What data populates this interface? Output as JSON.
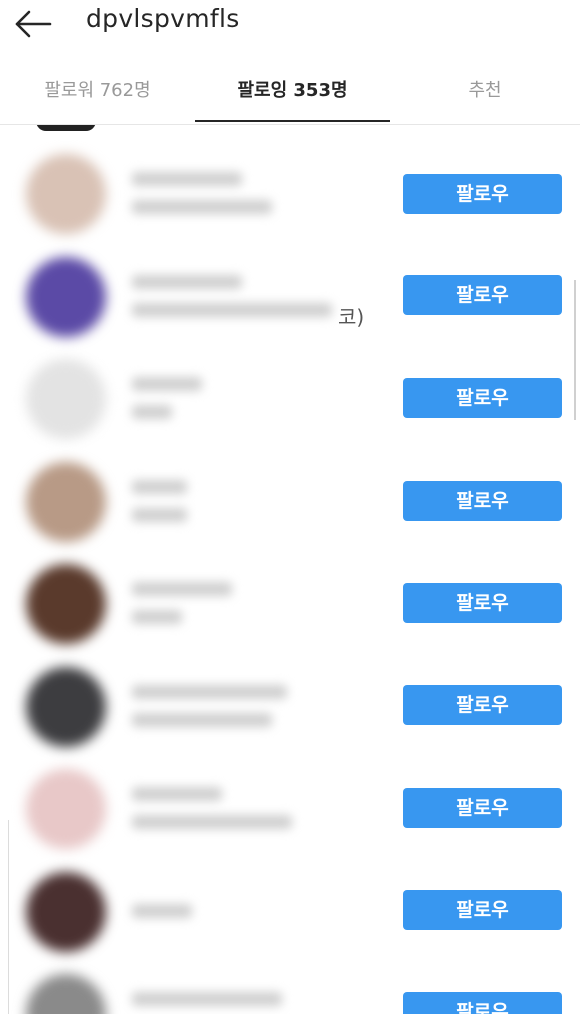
{
  "header": {
    "title": "dpvlspvmfls"
  },
  "tabs": [
    {
      "label": "팔로워 762명"
    },
    {
      "label": "팔로잉 353명"
    },
    {
      "label": "추천"
    }
  ],
  "list": {
    "button_label": "팔로우",
    "partial_text": "코)",
    "rows": [
      {
        "avatar_color": "#d9c2b5"
      },
      {
        "avatar_color": "#5b4aa6"
      },
      {
        "avatar_color": "#e3e3e3"
      },
      {
        "avatar_color": "#b89a86"
      },
      {
        "avatar_color": "#5a3a2c"
      },
      {
        "avatar_color": "#3d3d40"
      },
      {
        "avatar_color": "#e8c8c8"
      },
      {
        "avatar_color": "#4a3030"
      },
      {
        "avatar_color": "#8a8a8a"
      }
    ]
  },
  "colors": {
    "accent": "#3897f0",
    "active_tab": "#262626",
    "inactive_tab": "#999999"
  }
}
